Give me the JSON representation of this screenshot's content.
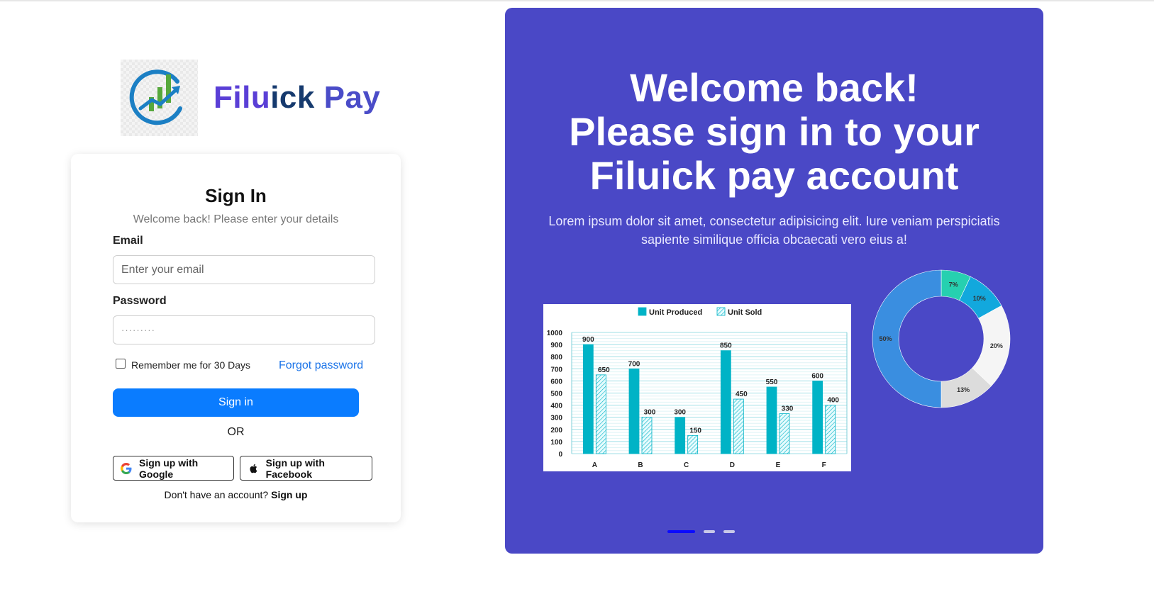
{
  "brand": {
    "part1": "Filu",
    "part2": "ick",
    "part3": " Pay",
    "logo_icon": "growth-chart-logo"
  },
  "signin": {
    "title": "Sign In",
    "subtitle": "Welcome back! Please enter your details",
    "email_label": "Email",
    "email_placeholder": "Enter your email",
    "password_label": "Password",
    "password_placeholder": "·········",
    "remember_label": "Remember me for 30 Days",
    "forgot_label": "Forgot password",
    "submit_label": "Sign in",
    "or_label": "OR",
    "google_label": "Sign up with Google",
    "facebook_label": "Sign up with Facebook",
    "no_account_text": "Don't have an account?",
    "signup_link": "Sign up"
  },
  "panel": {
    "heading_line1": "Welcome back!",
    "heading_line2": "Please sign in to your",
    "heading_line3": "Filuick pay account",
    "description": "Lorem ipsum dolor sit amet, consectetur adipisicing elit. Iure veniam perspiciatis sapiente similique officia obcaecati vero eius a!",
    "carousel_count": 3,
    "carousel_active": 0
  },
  "colors": {
    "accent": "#0a7cff",
    "panel": "#4a48c6",
    "bar": "#00b3c6",
    "link": "#1a73e8"
  },
  "chart_data": [
    {
      "type": "bar",
      "categories": [
        "A",
        "B",
        "C",
        "D",
        "E",
        "F"
      ],
      "series": [
        {
          "name": "Unit Produced",
          "values": [
            900,
            700,
            300,
            850,
            550,
            600
          ]
        },
        {
          "name": "Unit Sold",
          "values": [
            650,
            300,
            150,
            450,
            330,
            400
          ]
        }
      ],
      "yticks": [
        "0",
        "100",
        "200",
        "300",
        "400",
        "500",
        "600",
        "700",
        "800",
        "900",
        "1000"
      ],
      "ylim": [
        0,
        1000
      ],
      "legend": "top"
    },
    {
      "type": "pie",
      "donut": true,
      "slices": [
        {
          "label": "7%",
          "value": 7,
          "color": "#26d0b0"
        },
        {
          "label": "10%",
          "value": 10,
          "color": "#12a8dd"
        },
        {
          "label": "20%",
          "value": 20,
          "color": "#f5f5f5"
        },
        {
          "label": "13%",
          "value": 13,
          "color": "#dcdcdc"
        },
        {
          "label": "50%",
          "value": 50,
          "color": "#3a8ee0"
        }
      ]
    }
  ]
}
